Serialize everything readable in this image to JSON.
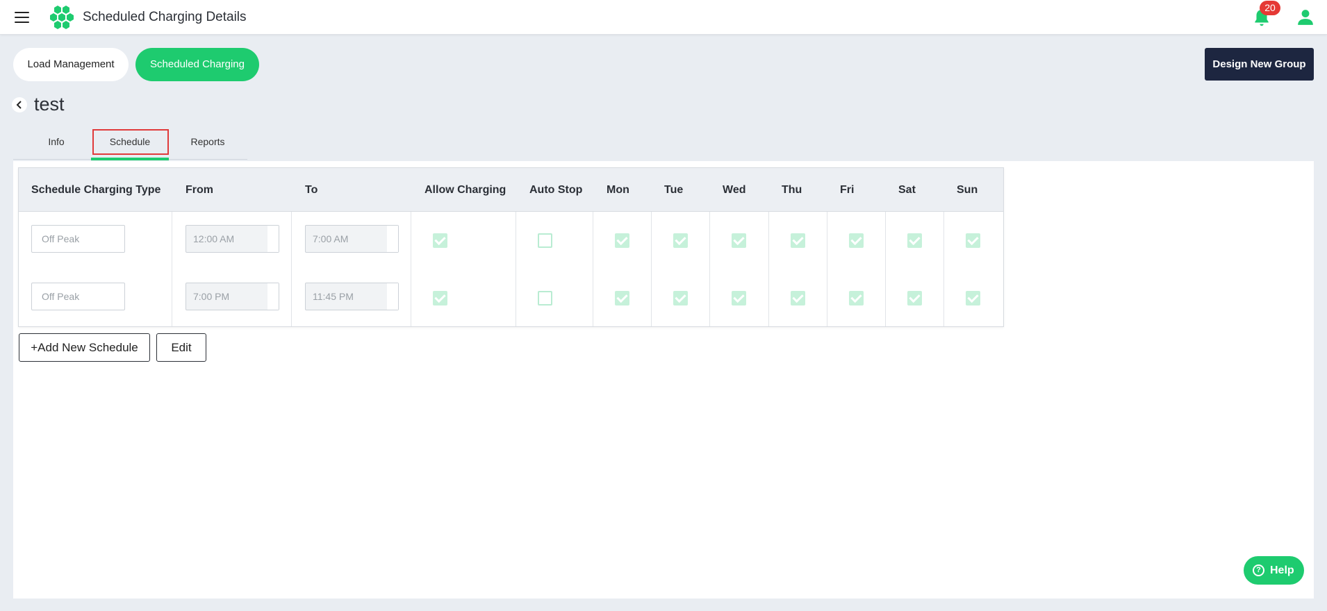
{
  "header": {
    "title": "Scheduled Charging Details",
    "notification_count": "20"
  },
  "nav": {
    "load_management": "Load Management",
    "scheduled_charging": "Scheduled Charging",
    "design_new_group": "Design New Group"
  },
  "group": {
    "name": "test"
  },
  "tabs": [
    {
      "label": "Info",
      "active": false
    },
    {
      "label": "Schedule",
      "active": true
    },
    {
      "label": "Reports",
      "active": false
    }
  ],
  "table": {
    "columns": [
      "Schedule Charging Type",
      "From",
      "To",
      "Allow Charging",
      "Auto Stop",
      "Mon",
      "Tue",
      "Wed",
      "Thu",
      "Fri",
      "Sat",
      "Sun"
    ],
    "rows": [
      {
        "type_placeholder": "Off Peak",
        "from": "12:00 AM",
        "to": "7:00 AM",
        "allow_charging": true,
        "auto_stop": false,
        "days": [
          true,
          true,
          true,
          true,
          true,
          true,
          true
        ]
      },
      {
        "type_placeholder": "Off Peak",
        "from": "7:00 PM",
        "to": "11:45 PM",
        "allow_charging": true,
        "auto_stop": false,
        "days": [
          true,
          true,
          true,
          true,
          true,
          true,
          true
        ]
      }
    ]
  },
  "actions": {
    "add_schedule": "+Add New Schedule",
    "edit": "Edit"
  },
  "help": {
    "label": "Help"
  },
  "colors": {
    "accent": "#1ecb6f",
    "dark_button": "#1d2640",
    "badge": "#e53935",
    "highlight": "#e03a3a"
  }
}
